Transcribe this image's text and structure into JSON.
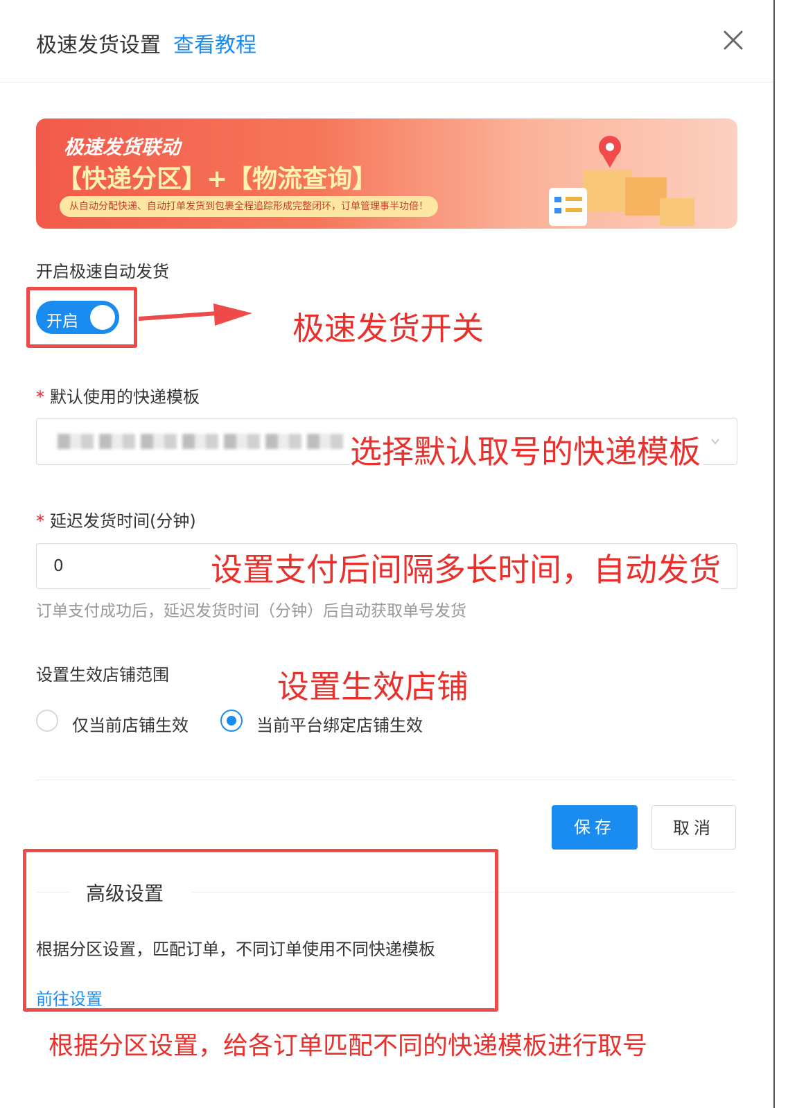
{
  "dialog": {
    "title": "极速发货设置",
    "tutorial_link": "查看教程"
  },
  "banner": {
    "title": "极速发货联动",
    "subtitle": "【快递分区】+【物流查询】",
    "tagline": "从自动分配快递、自动打单发货到包裹全程追踪形成完整闭环，订单管理事半功倍！"
  },
  "auto_ship": {
    "label": "开启极速自动发货",
    "toggle_text": "开启",
    "enabled": true
  },
  "template": {
    "required_mark": "*",
    "label": "默认使用的快递模板"
  },
  "delay": {
    "required_mark": "*",
    "label": "延迟发货时间(分钟)",
    "value": "0",
    "hint": "订单支付成功后，延迟发货时间（分钟）后自动获取单号发货"
  },
  "scope": {
    "label": "设置生效店铺范围",
    "options": [
      "仅当前店铺生效",
      "当前平台绑定店铺生效"
    ],
    "selected_index": 1
  },
  "buttons": {
    "save": "保存",
    "cancel": "取消"
  },
  "advanced": {
    "title": "高级设置",
    "description": "根据分区设置，匹配订单，不同订单使用不同快递模板",
    "link": "前往设置"
  },
  "annotations": {
    "toggle": "极速发货开关",
    "template": "选择默认取号的快递模板",
    "delay": "设置支付后间隔多长时间，自动发货",
    "scope": "设置生效店铺",
    "advanced": "根据分区设置，给各订单匹配不同的快递模板进行取号"
  },
  "colors": {
    "primary": "#1a8cf0",
    "annotation_red": "#e8302c",
    "required": "#f5222d"
  }
}
